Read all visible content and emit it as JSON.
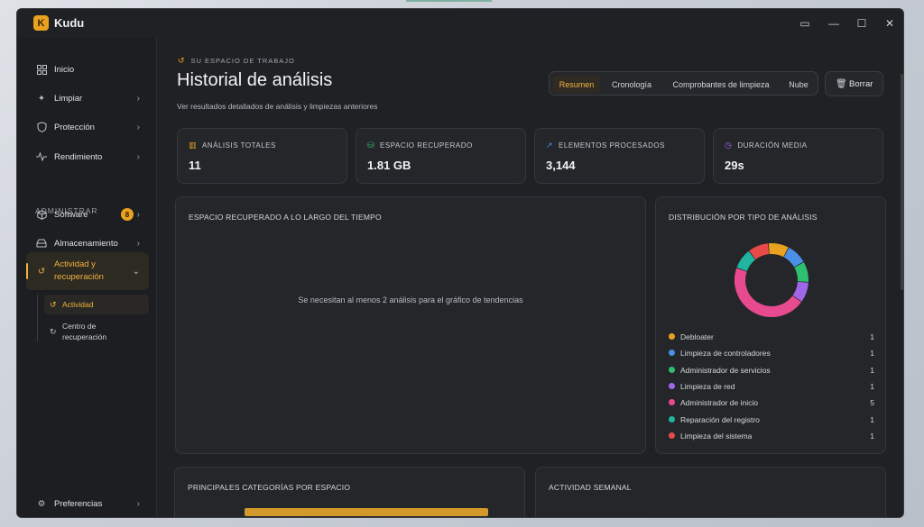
{
  "window": {
    "title": "Kudu",
    "logo_glyph": "K"
  },
  "sidebar": {
    "items": [
      {
        "label": "Inicio",
        "icon": "grid-icon"
      },
      {
        "label": "Limpiar",
        "icon": "sparkle-icon"
      },
      {
        "label": "Protección",
        "icon": "shield-icon"
      },
      {
        "label": "Rendimiento",
        "icon": "pulse-icon"
      }
    ],
    "section_title": "ADMINISTRAR",
    "admin_items": [
      {
        "label": "Software",
        "icon": "box-icon",
        "badge": "8"
      },
      {
        "label": "Almacenamiento",
        "icon": "drive-icon"
      },
      {
        "label": "Actividad y recuperación",
        "icon": "history-icon"
      }
    ],
    "sub_items": [
      {
        "label": "Actividad",
        "icon": "history-icon"
      },
      {
        "label": "Centro de recuperación",
        "icon": "restore-icon"
      }
    ],
    "footer_item": {
      "label": "Preferencias",
      "icon": "gear-icon"
    }
  },
  "header": {
    "eyebrow": "SU ESPACIO DE TRABAJO",
    "title": "Historial de análisis",
    "subtitle": "Ver resultados detallados de análisis y limpiezas anteriores",
    "tabs": [
      "Resumen",
      "Cronología",
      "Comprobantes de limpieza",
      "Nube"
    ],
    "delete_label": "Borrar"
  },
  "stats": [
    {
      "label": "ANÁLISIS TOTALES",
      "value": "11",
      "icon": "bar-chart-icon",
      "color": "#e8a21f"
    },
    {
      "label": "ESPACIO RECUPERADO",
      "value": "1.81 GB",
      "icon": "drive-icon",
      "color": "#2fbf71"
    },
    {
      "label": "ELEMENTOS PROCESADOS",
      "value": "3,144",
      "icon": "trend-icon",
      "color": "#4a8fe8"
    },
    {
      "label": "DURACIÓN MEDIA",
      "value": "29s",
      "icon": "clock-icon",
      "color": "#a066e8"
    }
  ],
  "trend_panel": {
    "title": "ESPACIO RECUPERADO A LO LARGO DEL TIEMPO",
    "empty_message": "Se necesitan al menos 2 análisis para el gráfico de tendencias"
  },
  "distribution_panel": {
    "title": "DISTRIBUCIÓN POR TIPO DE ANÁLISIS",
    "legend": [
      {
        "name": "Debloater",
        "count": "1",
        "color": "#e8a21f"
      },
      {
        "name": "Limpieza de controladores",
        "count": "1",
        "color": "#4a8fe8"
      },
      {
        "name": "Administrador de servicios",
        "count": "1",
        "color": "#2fbf71"
      },
      {
        "name": "Limpieza de red",
        "count": "1",
        "color": "#a066e8"
      },
      {
        "name": "Administrador de inicio",
        "count": "5",
        "color": "#e84a8f"
      },
      {
        "name": "Reparación del registro",
        "count": "1",
        "color": "#1fb5a0"
      },
      {
        "name": "Limpieza del sistema",
        "count": "1",
        "color": "#e84a4a"
      }
    ]
  },
  "bottom_panels": {
    "left_title": "PRINCIPALES CATEGORÍAS POR ESPACIO",
    "right_title": "ACTIVIDAD SEMANAL"
  },
  "chart_data": {
    "type": "pie",
    "categories": [
      "Debloater",
      "Limpieza de controladores",
      "Administrador de servicios",
      "Limpieza de red",
      "Administrador de inicio",
      "Reparación del registro",
      "Limpieza del sistema"
    ],
    "values": [
      1,
      1,
      1,
      1,
      5,
      1,
      1
    ],
    "colors": [
      "#e8a21f",
      "#4a8fe8",
      "#2fbf71",
      "#a066e8",
      "#e84a8f",
      "#1fb5a0",
      "#e84a4a"
    ],
    "title": "DISTRIBUCIÓN POR TIPO DE ANÁLISIS"
  }
}
